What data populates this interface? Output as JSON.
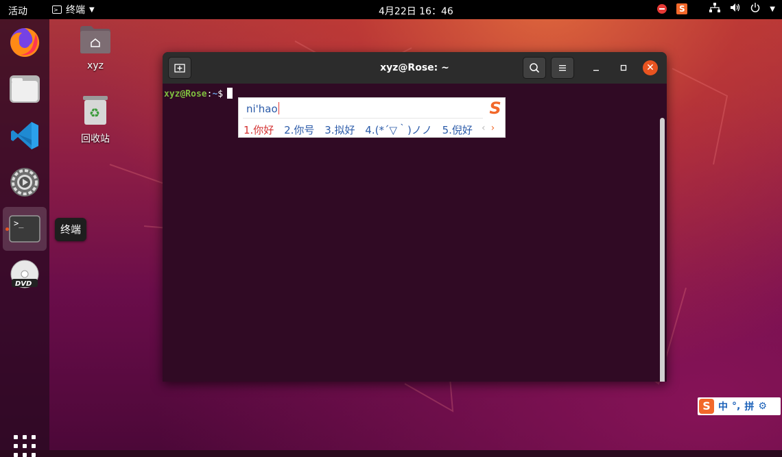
{
  "topbar": {
    "activities": "活动",
    "app_name": "终端",
    "clock": "4月22日  16：46"
  },
  "dock": {
    "tooltip": "终端",
    "items": [
      "firefox",
      "files",
      "vscode",
      "settings",
      "terminal",
      "dvd"
    ]
  },
  "desktop": {
    "icons": [
      {
        "label": "xyz"
      },
      {
        "label": "回收站"
      }
    ]
  },
  "terminal": {
    "title": "xyz@Rose: ~",
    "prompt_user": "xyz@Rose",
    "prompt_sep": ":",
    "prompt_path": "~",
    "prompt_symbol": "$"
  },
  "ime": {
    "input": "ni'hao",
    "candidates": [
      "1.你好",
      "2.你号",
      "3.拟好",
      "4.(*´▽｀)ノノ",
      "5.倪好"
    ],
    "logo": "S",
    "status": {
      "lang": "中",
      "punct": "°,",
      "mode": "拼"
    }
  },
  "colors": {
    "accent": "#e95420",
    "terminal_bg": "#300a24",
    "prompt_user": "#7fbf3f",
    "prompt_path": "#6a9fe0",
    "sogou": "#f2682a"
  }
}
